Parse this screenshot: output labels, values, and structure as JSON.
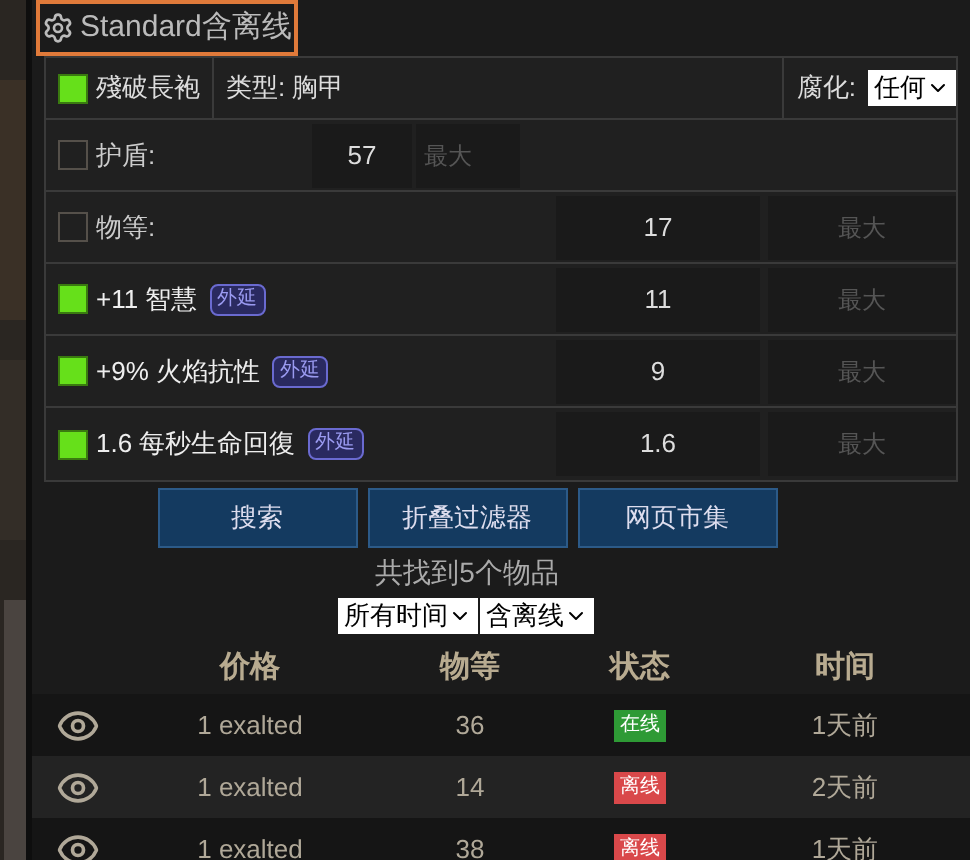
{
  "league": {
    "label": "Standard含离线"
  },
  "item": {
    "name": "殘破長袍",
    "checked": true,
    "type_label": "类型:",
    "type_value": "胸甲",
    "corrupted_label": "腐化:",
    "corrupted_value": "任何"
  },
  "filters": [
    {
      "kind": "compact",
      "label": "护盾:",
      "checked": false,
      "min": "57",
      "max_placeholder": "最大"
    },
    {
      "kind": "wide",
      "label": "物等:",
      "checked": false,
      "min": "17",
      "max_placeholder": "最大"
    },
    {
      "kind": "wide",
      "label": "+11 智慧",
      "tag": "外延",
      "checked": true,
      "min": "11",
      "max_placeholder": "最大"
    },
    {
      "kind": "wide",
      "label": "+9% 火焰抗性",
      "tag": "外延",
      "checked": true,
      "min": "9",
      "max_placeholder": "最大"
    },
    {
      "kind": "wide",
      "label": "1.6 每秒生命回復",
      "tag": "外延",
      "checked": true,
      "min": "1.6",
      "max_placeholder": "最大"
    }
  ],
  "buttons": [
    "搜索",
    "折叠过滤器",
    "网页市集"
  ],
  "result_count": "共找到5个物品",
  "selects": [
    "所有时间",
    "含离线"
  ],
  "table": {
    "columns": [
      "价格",
      "物等",
      "状态",
      "时间"
    ],
    "rows": [
      {
        "price": "1 exalted",
        "level": "36",
        "status": "在线",
        "online": true,
        "time": "1天前"
      },
      {
        "price": "1 exalted",
        "level": "14",
        "status": "离线",
        "online": false,
        "time": "2天前"
      },
      {
        "price": "1 exalted",
        "level": "38",
        "status": "离线",
        "online": false,
        "time": "1天前"
      }
    ]
  }
}
